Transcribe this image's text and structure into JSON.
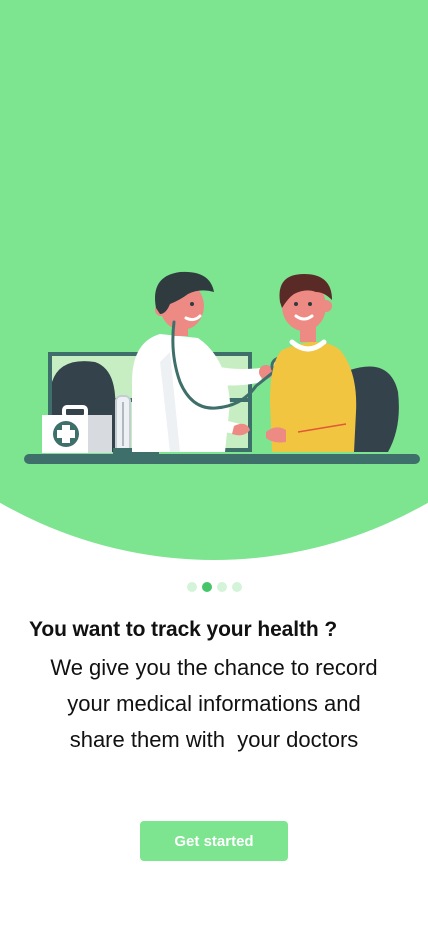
{
  "onboarding": {
    "headline": "You want to track your health ?",
    "description_line1": "We give you the chance to record",
    "description_line2": "your medical informations and",
    "description_line3": "share them with  your doctors",
    "cta_label": "Get started",
    "pagination": {
      "total": 4,
      "active_index": 1
    }
  },
  "illustration": {
    "subject": "doctor-examining-patient"
  },
  "colors": {
    "brand_green": "#7de490",
    "active_dot": "#46c569",
    "inactive_dot": "#d4f4d9",
    "text": "#111111",
    "button_text": "#ffffff"
  }
}
